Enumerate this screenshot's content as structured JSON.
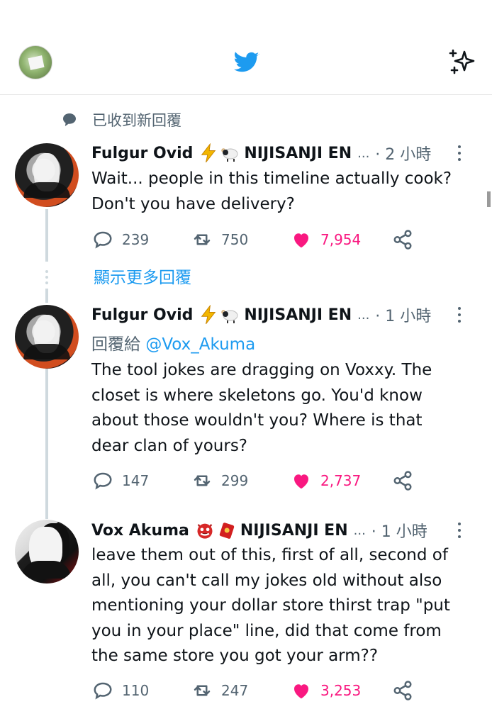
{
  "header": {
    "logo_icon": "twitter-bird-icon",
    "top_right_icon": "sparkle-icon"
  },
  "notice": {
    "text": "已收到新回覆",
    "icon": "speech-bubble-icon"
  },
  "tweets": [
    {
      "name": "Fulgur Ovid",
      "badges": [
        "⚡",
        "🐑"
      ],
      "handle": "NIJISANJI EN",
      "ellipsis": "...",
      "time": "· 2 小時",
      "reply_to_prefix": "",
      "reply_to_mention": "",
      "text_lines": [
        "Wait... people in this timeline actually cook?",
        "Don't you have delivery?"
      ],
      "stats": {
        "replies": "239",
        "retweets": "750",
        "likes": "7,954"
      }
    },
    {
      "name": "Fulgur Ovid",
      "badges": [
        "⚡",
        "🐑"
      ],
      "handle": "NIJISANJI EN",
      "ellipsis": "...",
      "time": "· 1 小時",
      "reply_to_prefix": "回覆給",
      "reply_to_mention": "@Vox_Akuma",
      "text_lines": [
        "The tool jokes are dragging on Voxxy. The",
        "closet is where skeletons go. You'd know",
        "about those wouldn't you? Where is that",
        "dear clan of yours?"
      ],
      "stats": {
        "replies": "147",
        "retweets": "299",
        "likes": "2,737"
      }
    },
    {
      "name": "Vox Akuma",
      "badges": [
        "👹",
        "🧧"
      ],
      "handle": "NIJISANJI EN",
      "ellipsis": "...",
      "time": "· 1 小時",
      "reply_to_prefix": "",
      "reply_to_mention": "",
      "text_lines": [
        "leave them out of this, first of all, second of",
        "all, you can't call my jokes old without also",
        "mentioning your dollar store thirst trap \"put",
        "you in your place\" line, did that come from",
        "the same store you got your arm??"
      ],
      "stats": {
        "replies": "110",
        "retweets": "247",
        "likes": "3,253"
      }
    }
  ],
  "show_more_replies": "顯示更多回覆",
  "colors": {
    "accent": "#1d9bf0",
    "like": "#f91880",
    "muted": "#536471",
    "text": "#0f1419",
    "divider": "#cfd9de"
  }
}
